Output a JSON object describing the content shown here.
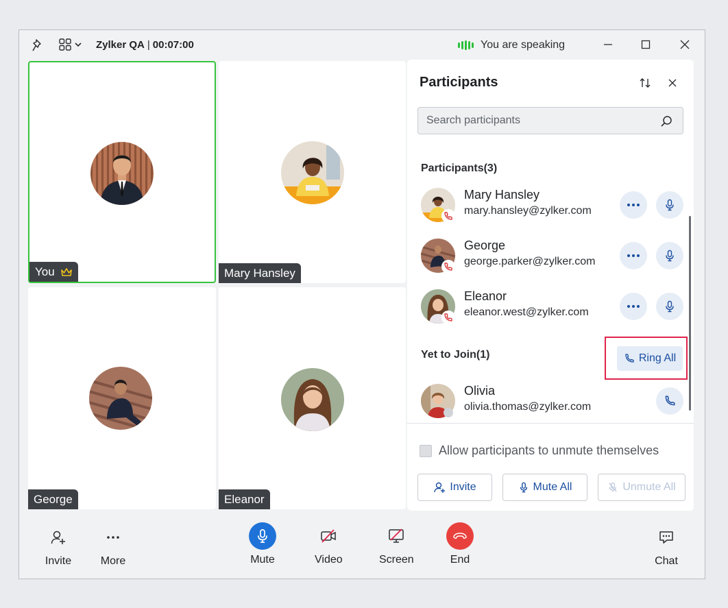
{
  "titlebar": {
    "meeting_name": "Zylker QA",
    "separator": "|",
    "duration": "00:07:00",
    "speaking_status": "You are speaking"
  },
  "tiles": [
    {
      "label": "You",
      "host_icon": "crown-icon"
    },
    {
      "label": "Mary Hansley"
    },
    {
      "label": "George"
    },
    {
      "label": "Eleanor"
    }
  ],
  "panel": {
    "title": "Participants",
    "search_placeholder": "Search participants",
    "participants_heading": "Participants(3)",
    "participants": [
      {
        "name": "Mary Hansley",
        "email": "mary.hansley@zylker.com"
      },
      {
        "name": "George",
        "email": "george.parker@zylker.com"
      },
      {
        "name": "Eleanor",
        "email": "eleanor.west@zylker.com"
      }
    ],
    "yet_to_join_heading": "Yet to Join(1)",
    "ring_all_label": "Ring All",
    "yet_to_join": [
      {
        "name": "Olivia",
        "email": "olivia.thomas@zylker.com"
      }
    ],
    "allow_unmute_label": "Allow participants to unmute themselves",
    "allow_unmute_checked": false,
    "invite_label": "Invite",
    "mute_all_label": "Mute All",
    "unmute_all_label": "Unmute All"
  },
  "toolbar": {
    "invite": "Invite",
    "more": "More",
    "mute": "Mute",
    "video": "Video",
    "screen": "Screen",
    "end": "End",
    "chat": "Chat"
  },
  "colors": {
    "accent": "#1a4ea0",
    "mute_button": "#1f73d8",
    "end_button": "#e8413d",
    "active_speaker_border": "#35c43c",
    "highlight": "#e0244a"
  }
}
